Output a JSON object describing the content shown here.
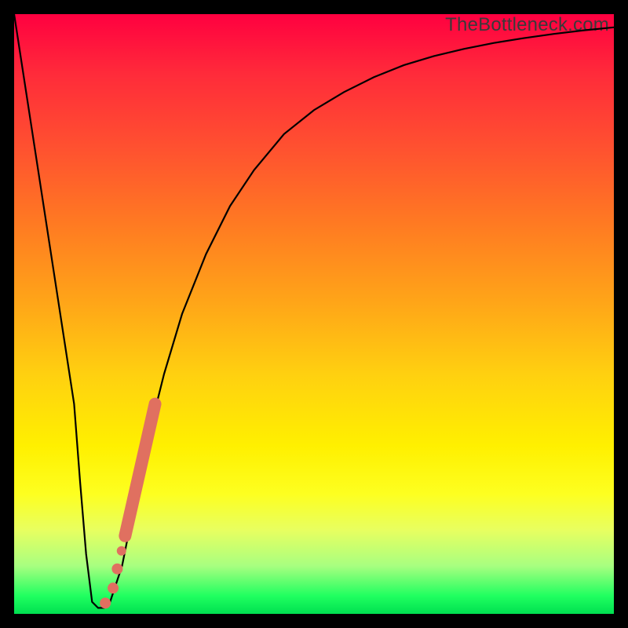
{
  "watermark": "TheBottleneck.com",
  "chart_data": {
    "type": "line",
    "title": "",
    "xlabel": "",
    "ylabel": "",
    "xlim": [
      0,
      100
    ],
    "ylim": [
      0,
      100
    ],
    "grid": false,
    "series": [
      {
        "name": "bottleneck-curve",
        "color": "#000000",
        "x": [
          0,
          2,
          4,
          6,
          8,
          10,
          11,
          12,
          13,
          14,
          15,
          16,
          18,
          20,
          22,
          25,
          28,
          32,
          36,
          40,
          45,
          50,
          55,
          60,
          65,
          70,
          75,
          80,
          85,
          90,
          95,
          100
        ],
        "y": [
          100,
          87,
          74,
          61,
          48,
          35,
          22,
          10,
          2,
          1,
          1,
          2,
          8,
          18,
          28,
          40,
          50,
          60,
          68,
          74,
          80,
          84,
          87,
          89.5,
          91.5,
          93,
          94.2,
          95.2,
          96,
          96.7,
          97.3,
          97.8
        ]
      }
    ],
    "markers": [
      {
        "name": "highlight-segment",
        "shape": "stroke",
        "color": "#e07060",
        "width": 16,
        "x": [
          18.5,
          23.5
        ],
        "y": [
          13,
          35
        ]
      },
      {
        "name": "dot-1",
        "shape": "circle",
        "color": "#e07060",
        "r": 7,
        "x": 17.2,
        "y": 7.5
      },
      {
        "name": "dot-2",
        "shape": "circle",
        "color": "#e07060",
        "r": 7,
        "x": 16.5,
        "y": 4.3
      },
      {
        "name": "dot-3",
        "shape": "circle",
        "color": "#e07060",
        "r": 7,
        "x": 15.2,
        "y": 1.8
      },
      {
        "name": "dot-4",
        "shape": "circle",
        "color": "#e07060",
        "r": 6,
        "x": 17.9,
        "y": 10.5
      }
    ]
  }
}
